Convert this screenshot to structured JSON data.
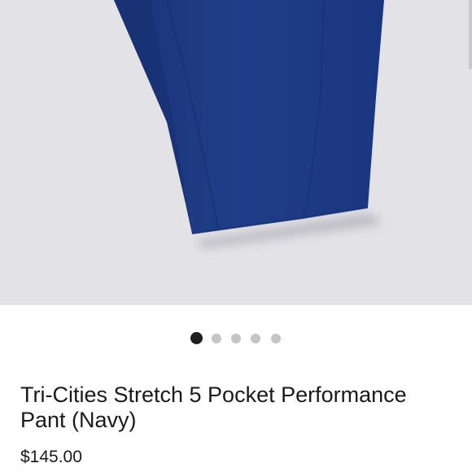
{
  "product": {
    "title": "Tri-Cities Stretch 5 Pocket Performance Pant (Navy)",
    "price": "$145.00",
    "image_description_icon": "pant-leg-image",
    "colors": {
      "image_background": "#e3e2e7",
      "pant_navy": "#1d3a82",
      "text": "#1a1a1a"
    }
  },
  "carousel": {
    "slide_count": 5,
    "active_index": 0,
    "colors": {
      "active": "#1e1e1e",
      "inactive": "#c5c5c5"
    }
  }
}
